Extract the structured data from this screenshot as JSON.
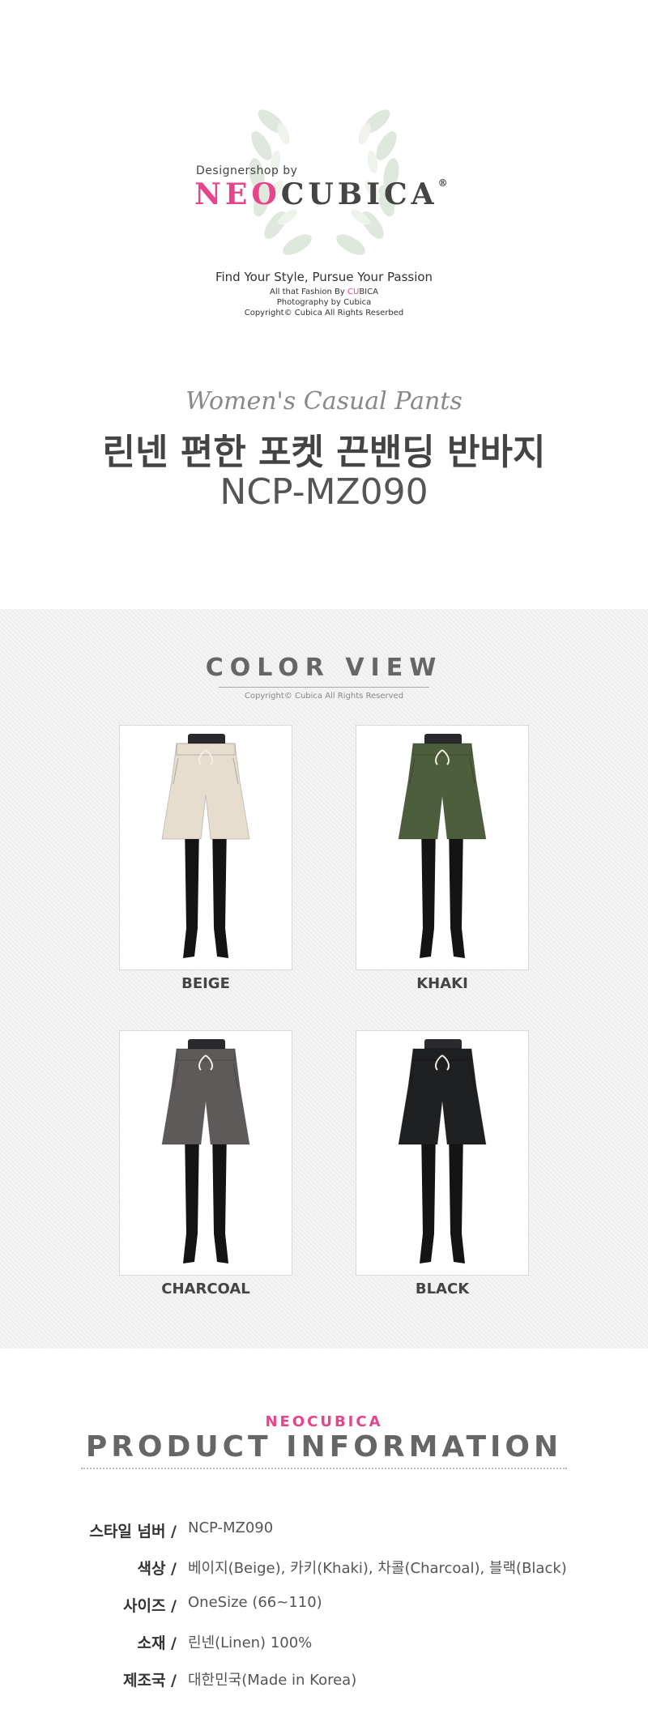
{
  "brand": {
    "tagline_small": "Designershop by",
    "name_neo": "NEO",
    "name_cubica": "CUBICA",
    "registered": "®",
    "slogan": "Find Your Style, Pursue Your Passion",
    "line1_prefix": "All that Fashion By ",
    "line1_accent": "CU",
    "line1_suffix": "BICA",
    "line2": "Photography by Cubica",
    "line3": "Copyright© Cubica All Rights Reserbed"
  },
  "product": {
    "subtitle": "Women's Casual Pants",
    "title": "린넨 편한 포켓 끈밴딩 반바지",
    "code": "NCP-MZ090"
  },
  "color_view": {
    "title": "COLOR VIEW",
    "copyright": "Copyright© Cubica All Rights Reserved",
    "items": [
      {
        "label": "BEIGE",
        "color": "#e6ddce"
      },
      {
        "label": "KHAKI",
        "color": "#4d5e3c"
      },
      {
        "label": "CHARCOAL",
        "color": "#5e5a59"
      },
      {
        "label": "BLACK",
        "color": "#1f2022"
      }
    ]
  },
  "info": {
    "brand": "NEOCUBICA",
    "title": "PRODUCT INFORMATION",
    "rows": [
      {
        "label": "스타일 넘버 /",
        "value": "NCP-MZ090"
      },
      {
        "label": "색상 /",
        "value": "베이지(Beige), 카키(Khaki), 차콜(Charcoal), 블랙(Black)"
      },
      {
        "label": "사이즈 /",
        "value": "OneSize (66~110)"
      },
      {
        "label": "소재 /",
        "value": "린넨(Linen) 100%"
      },
      {
        "label": "제조국 /",
        "value": "대한민국(Made in Korea)"
      }
    ]
  },
  "colors": {
    "accent": "#e6448b",
    "text": "#444444",
    "section_bg": "#efefef"
  }
}
